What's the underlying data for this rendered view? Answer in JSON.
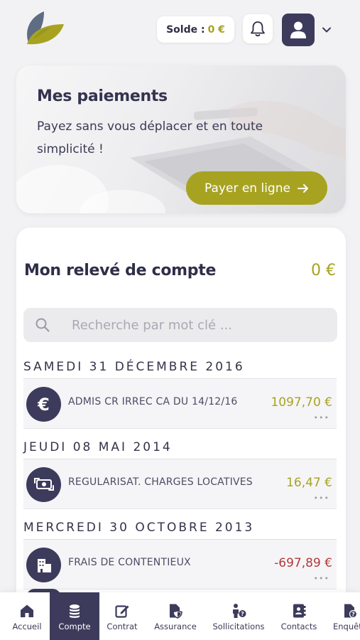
{
  "header": {
    "solde_label": "Solde :",
    "solde_amount": "0 €"
  },
  "banner": {
    "title": "Mes paiements",
    "text": "Payez sans vous déplacer et en toute simplicité !",
    "button_label": "Payer en ligne"
  },
  "statement": {
    "title": "Mon relevé de compte",
    "total": "0 €",
    "search_placeholder": "Recherche par mot clé ...",
    "groups": [
      {
        "date": "SAMEDI 31 DÉCEMBRE 2016",
        "transactions": [
          {
            "icon": "euro-icon",
            "label": "ADMIS CR IRREC CA DU 14/12/16",
            "amount": "1097,70 €",
            "type": "credit"
          }
        ]
      },
      {
        "date": "JEUDI 08 MAI 2014",
        "transactions": [
          {
            "icon": "money-exchange-icon",
            "label": "REGULARISAT. CHARGES LOCATIVES",
            "amount": "16,47 €",
            "type": "credit"
          }
        ]
      },
      {
        "date": "MERCREDI 30 OCTOBRE 2013",
        "transactions": [
          {
            "icon": "building-icon",
            "label": "FRAIS DE CONTENTIEUX",
            "amount": "-697,89 €",
            "type": "debit"
          }
        ]
      }
    ],
    "more_label": "•••"
  },
  "nav": [
    {
      "label": "Accueil",
      "icon": "home-icon",
      "active": false
    },
    {
      "label": "Compte",
      "icon": "coins-icon",
      "active": true
    },
    {
      "label": "Contrat",
      "icon": "edit-icon",
      "active": false
    },
    {
      "label": "Assurance",
      "icon": "file-shield-icon",
      "active": false
    },
    {
      "label": "Sollicitations",
      "icon": "person-question-icon",
      "active": false
    },
    {
      "label": "Contacts",
      "icon": "address-book-icon",
      "active": false
    },
    {
      "label": "Enquêtes",
      "icon": "file-question-icon",
      "active": false
    }
  ],
  "colors": {
    "primary": "#3d3b5c",
    "accent": "#a7a321",
    "debit": "#b23a3a"
  }
}
